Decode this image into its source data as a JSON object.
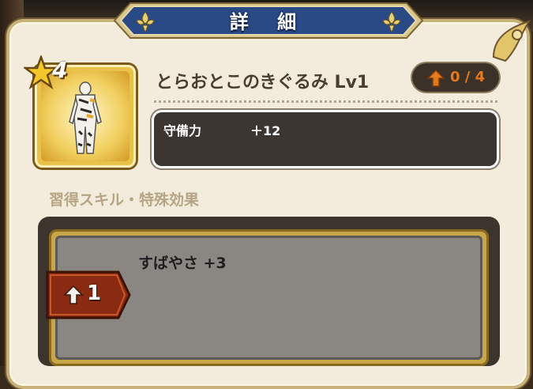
{
  "dialog": {
    "title": "詳 細"
  },
  "item": {
    "name": "とらおとこのきぐるみ Lv1",
    "rarity": "4",
    "upgrade": "0 / 4",
    "image": "tiger-costume-icon"
  },
  "stats": {
    "label": "守備力",
    "value": "＋12"
  },
  "skills": {
    "section_title": "習得スキル・特殊効果",
    "items": [
      {
        "required": "1",
        "text": "すばやさ +3"
      }
    ]
  },
  "colors": {
    "banner": "#2a4a86",
    "panel": "#f3ecdc",
    "upgrade_accent": "#e47a1e",
    "stat_box": "#3b3631"
  }
}
